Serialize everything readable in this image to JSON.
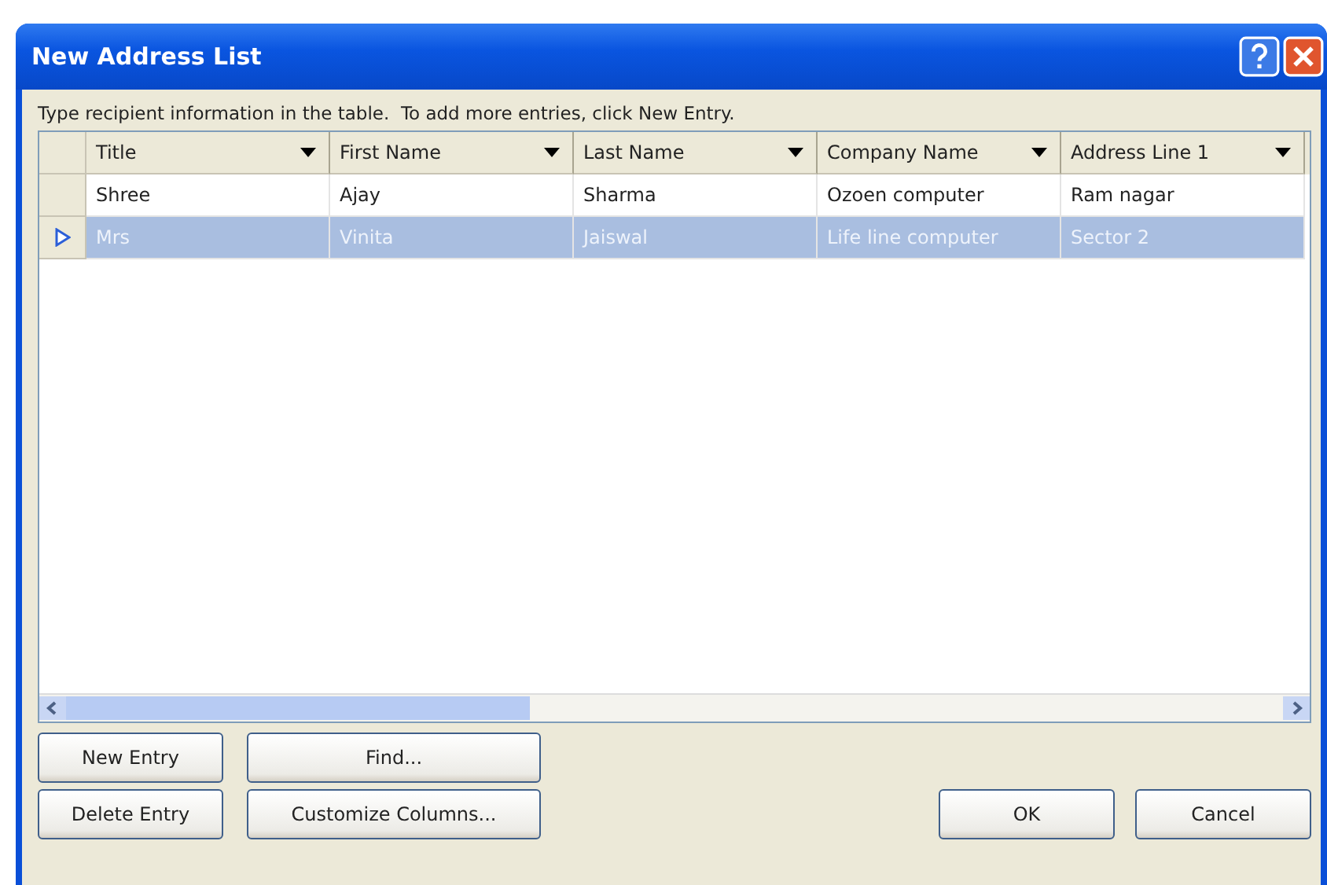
{
  "window": {
    "title": "New Address List"
  },
  "instruction": "Type recipient information in the table.  To add more entries, click New Entry.",
  "table": {
    "columns": [
      "Title",
      "First Name",
      "Last Name",
      "Company Name",
      "Address Line 1"
    ],
    "rows": [
      {
        "cells": [
          "Shree",
          "Ajay",
          "Sharma",
          "Ozoen computer",
          "Ram nagar"
        ],
        "selected": false
      },
      {
        "cells": [
          "Mrs",
          "Vinita",
          "Jaiswal",
          "Life line computer",
          "Sector 2"
        ],
        "selected": true
      }
    ]
  },
  "left_buttons": [
    [
      "New Entry",
      "Find..."
    ],
    [
      "Delete Entry",
      "Customize Columns..."
    ]
  ],
  "right_buttons": [
    "OK",
    "Cancel"
  ]
}
